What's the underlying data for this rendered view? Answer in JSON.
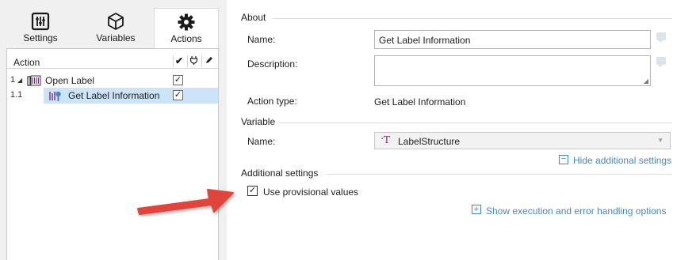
{
  "tabs": {
    "settings": "Settings",
    "variables": "Variables",
    "actions": "Actions"
  },
  "tree": {
    "header": "Action",
    "rows": [
      {
        "num": "1",
        "label": "Open Label",
        "checked": true
      },
      {
        "num": "1.1",
        "label": "Get Label Information",
        "checked": true,
        "selected": true
      }
    ]
  },
  "about": {
    "section": "About",
    "name_label": "Name:",
    "name_value": "Get Label Information",
    "description_label": "Description:",
    "description_value": "",
    "action_type_label": "Action type:",
    "action_type_value": "Get Label Information"
  },
  "variable": {
    "section": "Variable",
    "name_label": "Name:",
    "selected": "LabelStructure",
    "hide_additional": "Hide additional settings"
  },
  "additional": {
    "section": "Additional settings",
    "provisional_label": "Use provisional values",
    "provisional_checked": true,
    "show_execution": "Show execution and error handling options"
  },
  "colors": {
    "accent": "#4a86c5",
    "selection": "#cce4f7",
    "arrow": "#e0453a",
    "panel": "#f0f0f0"
  }
}
